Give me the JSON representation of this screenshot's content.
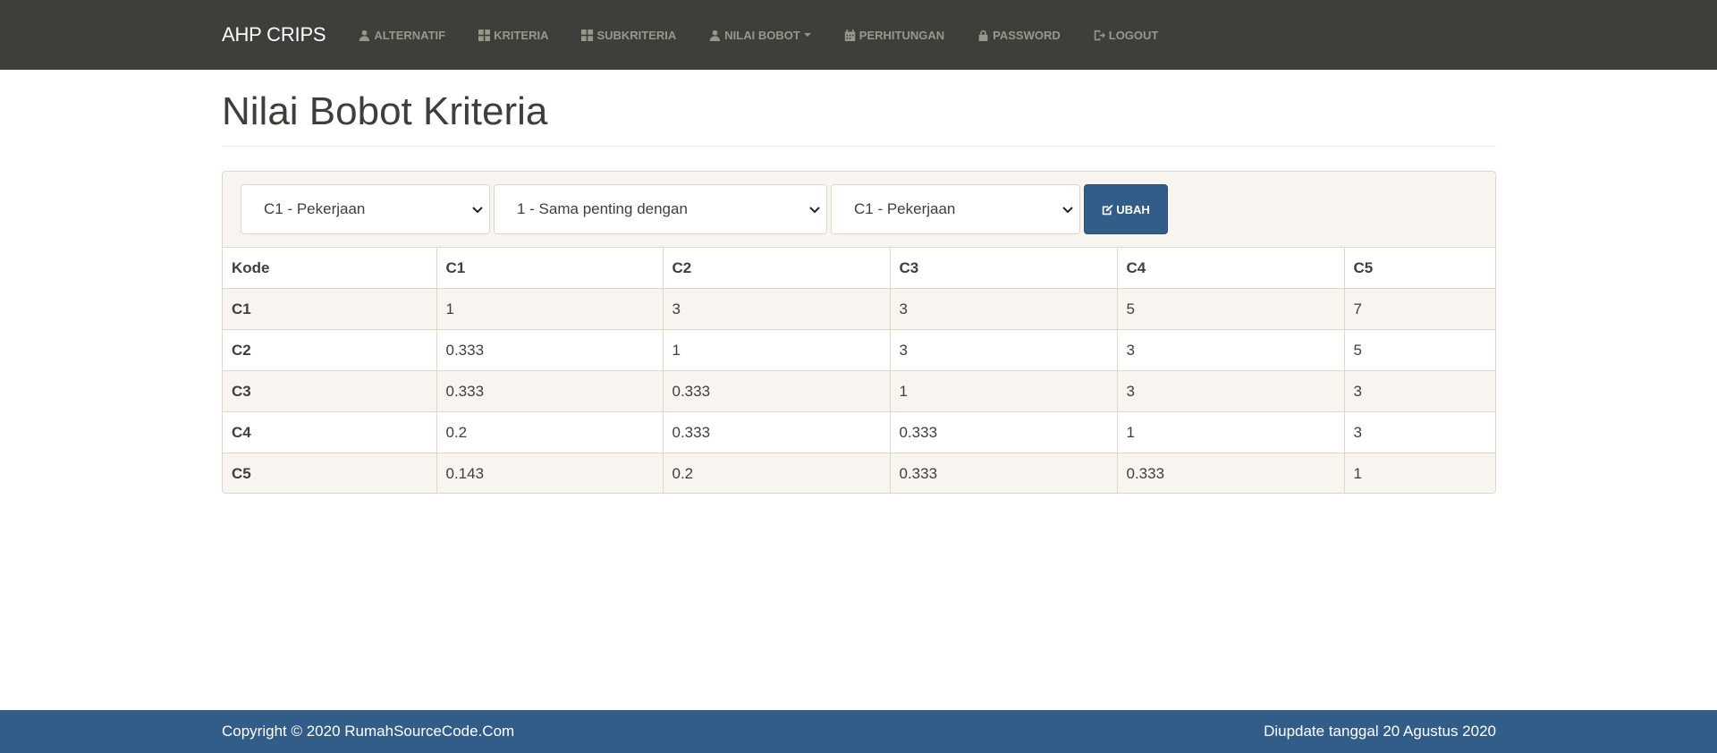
{
  "navbar": {
    "brand": "AHP CRIPS",
    "items": [
      {
        "label": "ALTERNATIF",
        "icon": "user-icon"
      },
      {
        "label": "KRITERIA",
        "icon": "grid-icon"
      },
      {
        "label": "SUBKRITERIA",
        "icon": "grid-icon"
      },
      {
        "label": "NILAI BOBOT",
        "icon": "user-icon",
        "dropdown": true
      },
      {
        "label": "PERHITUNGAN",
        "icon": "calendar-icon"
      },
      {
        "label": "PASSWORD",
        "icon": "lock-icon"
      },
      {
        "label": "LOGOUT",
        "icon": "logout-icon"
      }
    ]
  },
  "page": {
    "title": "Nilai Bobot Kriteria"
  },
  "form": {
    "criteria1": "C1 - Pekerjaan",
    "weight": "1 - Sama penting dengan",
    "criteria2": "C1 - Pekerjaan",
    "submit_label": "UBAH"
  },
  "table": {
    "headers": [
      "Kode",
      "C1",
      "C2",
      "C3",
      "C4",
      "C5"
    ],
    "rows": [
      [
        "C1",
        "1",
        "3",
        "3",
        "5",
        "7"
      ],
      [
        "C2",
        "0.333",
        "1",
        "3",
        "3",
        "5"
      ],
      [
        "C3",
        "0.333",
        "0.333",
        "1",
        "3",
        "3"
      ],
      [
        "C4",
        "0.2",
        "0.333",
        "0.333",
        "1",
        "3"
      ],
      [
        "C5",
        "0.143",
        "0.2",
        "0.333",
        "0.333",
        "1"
      ]
    ]
  },
  "footer": {
    "copyright": "Copyright © 2020 RumahSourceCode.Com",
    "updated": "Diupdate tanggal 20 Agustus 2020"
  },
  "colors": {
    "navbar_bg": "#3e3f3a",
    "primary": "#325d88",
    "panel_bg": "#f8f5f0"
  }
}
